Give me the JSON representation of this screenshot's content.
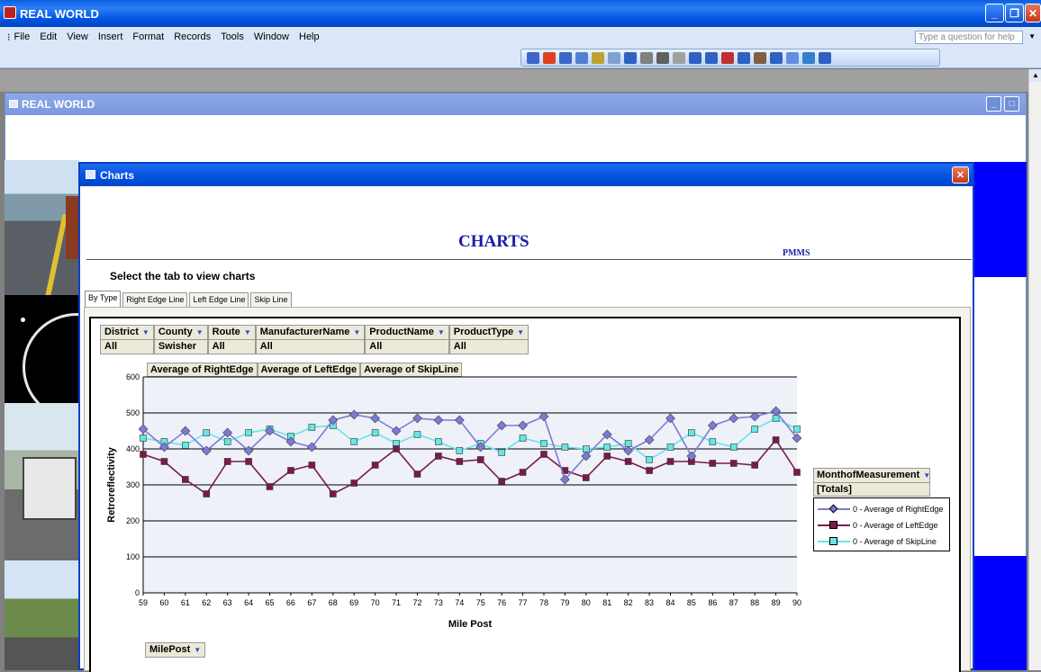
{
  "app": {
    "title": "REAL WORLD",
    "help_placeholder": "Type a question for help"
  },
  "menu": [
    "File",
    "Edit",
    "View",
    "Insert",
    "Format",
    "Records",
    "Tools",
    "Window",
    "Help"
  ],
  "mdi": {
    "title": "REAL WORLD"
  },
  "charts_window": {
    "title": "Charts",
    "heading": "CHARTS",
    "subheading": "PMMS",
    "instruction": "Select the tab to view charts"
  },
  "tabs": [
    "By Type",
    "Right Edge Line",
    "Left Edge Line",
    "Skip Line"
  ],
  "filters": [
    {
      "name": "District",
      "value": "All"
    },
    {
      "name": "County",
      "value": "Swisher"
    },
    {
      "name": "Route",
      "value": "All"
    },
    {
      "name": "ManufacturerName",
      "value": "All"
    },
    {
      "name": "ProductName",
      "value": "All"
    },
    {
      "name": "ProductType",
      "value": "All"
    }
  ],
  "data_fields": [
    "Average of RightEdge",
    "Average of LeftEdge",
    "Average of SkipLine"
  ],
  "month_field": {
    "label": "MonthofMeasurement",
    "value": "[Totals]"
  },
  "milepost_field": "MilePost",
  "chart_data": {
    "type": "line",
    "xlabel": "Mile Post",
    "ylabel": "Retroreflectivity",
    "ylim": [
      0,
      600
    ],
    "yticks": [
      0,
      100,
      200,
      300,
      400,
      500,
      600
    ],
    "x": [
      59,
      60,
      61,
      62,
      63,
      64,
      65,
      66,
      67,
      68,
      69,
      70,
      71,
      72,
      73,
      74,
      75,
      76,
      77,
      78,
      79,
      80,
      81,
      82,
      83,
      84,
      85,
      86,
      87,
      88,
      89,
      90
    ],
    "grid": true,
    "legend_position": "right",
    "series": [
      {
        "name": "0 - Average of RightEdge",
        "color": "#7b7bd6",
        "marker": "diamond",
        "values": [
          455,
          405,
          450,
          395,
          445,
          395,
          450,
          420,
          405,
          480,
          495,
          485,
          450,
          485,
          480,
          480,
          405,
          465,
          465,
          490,
          315,
          380,
          440,
          395,
          425,
          485,
          380,
          465,
          485,
          490,
          505,
          430
        ]
      },
      {
        "name": "0 - Average of LeftEdge",
        "color": "#7a1a4a",
        "marker": "square",
        "values": [
          385,
          365,
          315,
          275,
          365,
          365,
          295,
          340,
          355,
          275,
          305,
          355,
          400,
          330,
          380,
          365,
          370,
          310,
          335,
          385,
          340,
          320,
          380,
          365,
          340,
          365,
          365,
          360,
          360,
          355,
          425,
          335
        ]
      },
      {
        "name": "0 - Average of SkipLine",
        "color": "#66e6e6",
        "marker": "square",
        "values": [
          430,
          420,
          410,
          445,
          420,
          445,
          455,
          435,
          460,
          465,
          420,
          445,
          415,
          440,
          420,
          395,
          415,
          390,
          430,
          415,
          405,
          400,
          405,
          415,
          370,
          405,
          445,
          420,
          405,
          455,
          485,
          455
        ]
      }
    ]
  }
}
